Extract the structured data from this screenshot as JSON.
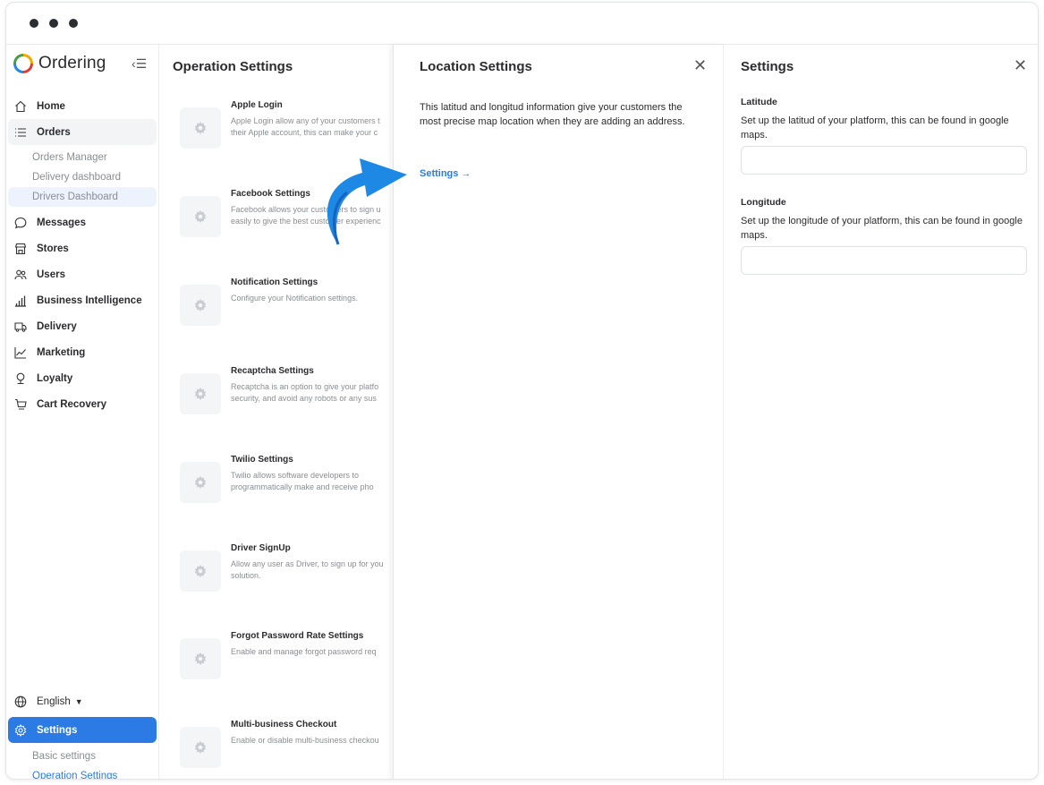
{
  "brand": {
    "name": "Ordering"
  },
  "sidebar": {
    "items": [
      {
        "label": "Home",
        "icon": "home-icon"
      },
      {
        "label": "Orders",
        "icon": "list-icon"
      },
      {
        "label": "Messages",
        "icon": "message-icon"
      },
      {
        "label": "Stores",
        "icon": "store-icon"
      },
      {
        "label": "Users",
        "icon": "users-icon"
      },
      {
        "label": "Business Intelligence",
        "icon": "bar-chart-icon"
      },
      {
        "label": "Delivery",
        "icon": "truck-icon"
      },
      {
        "label": "Marketing",
        "icon": "line-chart-icon"
      },
      {
        "label": "Loyalty",
        "icon": "award-icon"
      },
      {
        "label": "Cart Recovery",
        "icon": "cart-icon"
      }
    ],
    "orders_sub": [
      "Orders Manager",
      "Delivery dashboard",
      "Drivers Dashboard"
    ],
    "language": "English",
    "settings_label": "Settings",
    "settings_sub": [
      "Basic settings",
      "Operation Settings"
    ]
  },
  "operation": {
    "title": "Operation Settings",
    "items": [
      {
        "name": "Apple Login",
        "desc1": "Apple Login allow any of your customers t",
        "desc2": "their Apple account, this can make your c"
      },
      {
        "name": "Facebook Settings",
        "desc1": "Facebook allows your customers to sign u",
        "desc2": "easily to give the best customer experienc"
      },
      {
        "name": "Notification Settings",
        "desc1": "Configure your Notification settings.",
        "desc2": ""
      },
      {
        "name": "Recaptcha Settings",
        "desc1": "Recaptcha is an option to give your platfo",
        "desc2": "security, and avoid any robots or any sus"
      },
      {
        "name": "Twilio Settings",
        "desc1": "Twilio allows software developers to",
        "desc2": "programmatically make and receive pho"
      },
      {
        "name": "Driver SignUp",
        "desc1": "Allow any user as Driver, to sign up for you",
        "desc2": "solution."
      },
      {
        "name": "Forgot Password Rate Settings",
        "desc1": "Enable and manage forgot password req",
        "desc2": ""
      },
      {
        "name": "Multi-business Checkout",
        "desc1": "Enable or disable multi-business checkou",
        "desc2": ""
      }
    ]
  },
  "location": {
    "title": "Location Settings",
    "description": "This latitud and longitud information give your customers the most precise map location when they are adding an address.",
    "link": "Settings →"
  },
  "settings_panel": {
    "title": "Settings",
    "latitude_label": "Latitude",
    "latitude_help": "Set up the latitud of your platform, this can be found in google maps.",
    "latitude_value": "",
    "longitude_label": "Longitude",
    "longitude_help": "Set up the longitude of your platform, this can be found in google maps.",
    "longitude_value": ""
  },
  "colors": {
    "accent": "#2c7be5",
    "arrow": "#1e88e5"
  }
}
